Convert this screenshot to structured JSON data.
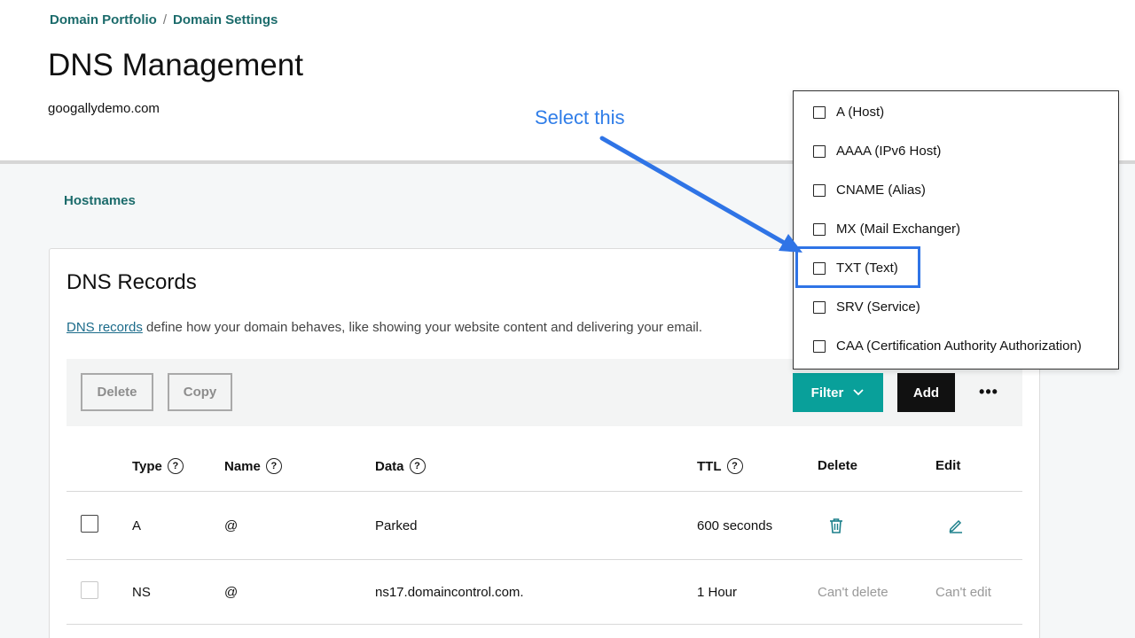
{
  "breadcrumb": {
    "item1": "Domain Portfolio",
    "separator": "/",
    "item2": "Domain Settings"
  },
  "page": {
    "title": "DNS Management",
    "domain": "googallydemo.com"
  },
  "tabs": {
    "hostnames": "Hostnames"
  },
  "card": {
    "title": "DNS Records",
    "desc_link": "DNS records",
    "desc_text": " define how your domain behaves, like showing your website content and delivering your email."
  },
  "toolbar": {
    "delete": "Delete",
    "copy": "Copy",
    "filter": "Filter",
    "add": "Add",
    "more": "•••"
  },
  "table": {
    "headers": {
      "type": "Type",
      "name": "Name",
      "data": "Data",
      "ttl": "TTL",
      "delete": "Delete",
      "edit": "Edit"
    },
    "rows": [
      {
        "type": "A",
        "name": "@",
        "data": "Parked",
        "ttl": "600 seconds",
        "delete": "trash-icon",
        "edit": "pencil-icon"
      },
      {
        "type": "NS",
        "name": "@",
        "data": "ns17.domaincontrol.com.",
        "ttl": "1 Hour",
        "delete": "Can't delete",
        "edit": "Can't edit"
      }
    ]
  },
  "filter_menu": {
    "items": [
      "A (Host)",
      "AAAA (IPv6 Host)",
      "CNAME (Alias)",
      "MX (Mail Exchanger)",
      "TXT (Text)",
      "SRV (Service)",
      "CAA (Certification Authority Authorization)"
    ]
  },
  "annotation": {
    "text": "Select this"
  },
  "colors": {
    "accent": "#09a09a",
    "link": "#1b6b6b",
    "annotation": "#2f7de8"
  }
}
